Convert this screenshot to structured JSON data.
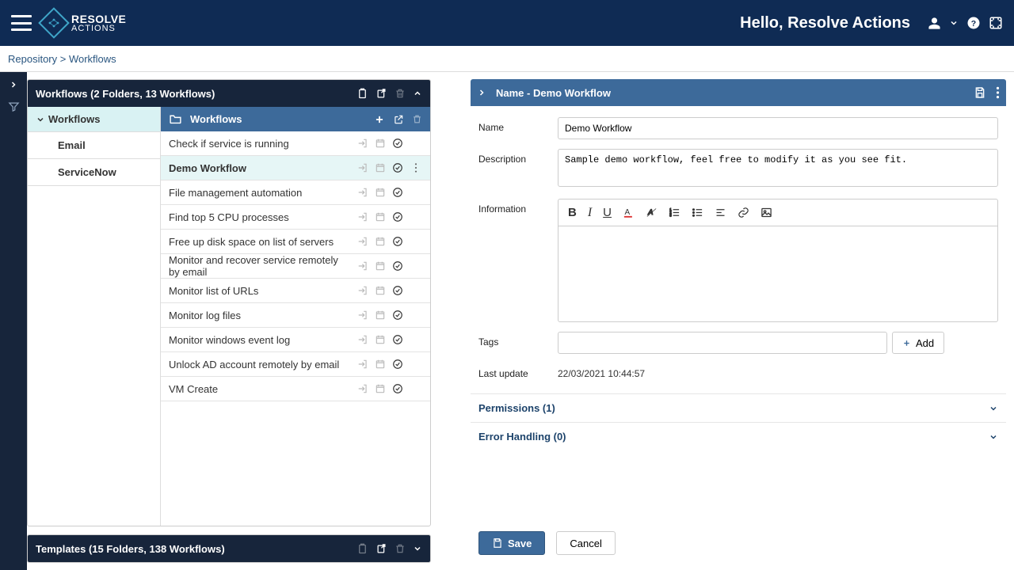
{
  "header": {
    "brand_top": "RESOLVE",
    "brand_bottom": "ACTIONS",
    "greeting": "Hello, Resolve Actions"
  },
  "breadcrumb": "Repository > Workflows",
  "workflows_panel": {
    "title": "Workflows (2 Folders, 13 Workflows)",
    "tree_root": "Workflows",
    "tree_items": [
      "Email",
      "ServiceNow"
    ],
    "list_header": "Workflows",
    "items": [
      "Check if service is running",
      "Demo Workflow",
      "File management automation",
      "Find top 5 CPU processes",
      "Free up disk space on list of servers",
      "Monitor and recover service remotely by email",
      "Monitor list of URLs",
      "Monitor log files",
      "Monitor windows event log",
      "Unlock AD account remotely by email",
      "VM Create"
    ],
    "selected_index": 1
  },
  "templates_panel": {
    "title": "Templates (15 Folders, 138 Workflows)"
  },
  "detail": {
    "header": "Name - Demo Workflow",
    "name_label": "Name",
    "name_value": "Demo Workflow",
    "desc_label": "Description",
    "desc_value": "Sample demo workflow, feel free to modify it as you see fit.",
    "info_label": "Information",
    "tags_label": "Tags",
    "add_label": "Add",
    "lastupdate_label": "Last update",
    "lastupdate_value": "22/03/2021 10:44:57",
    "permissions": "Permissions (1)",
    "errorhandling": "Error Handling (0)",
    "save_label": "Save",
    "cancel_label": "Cancel"
  }
}
